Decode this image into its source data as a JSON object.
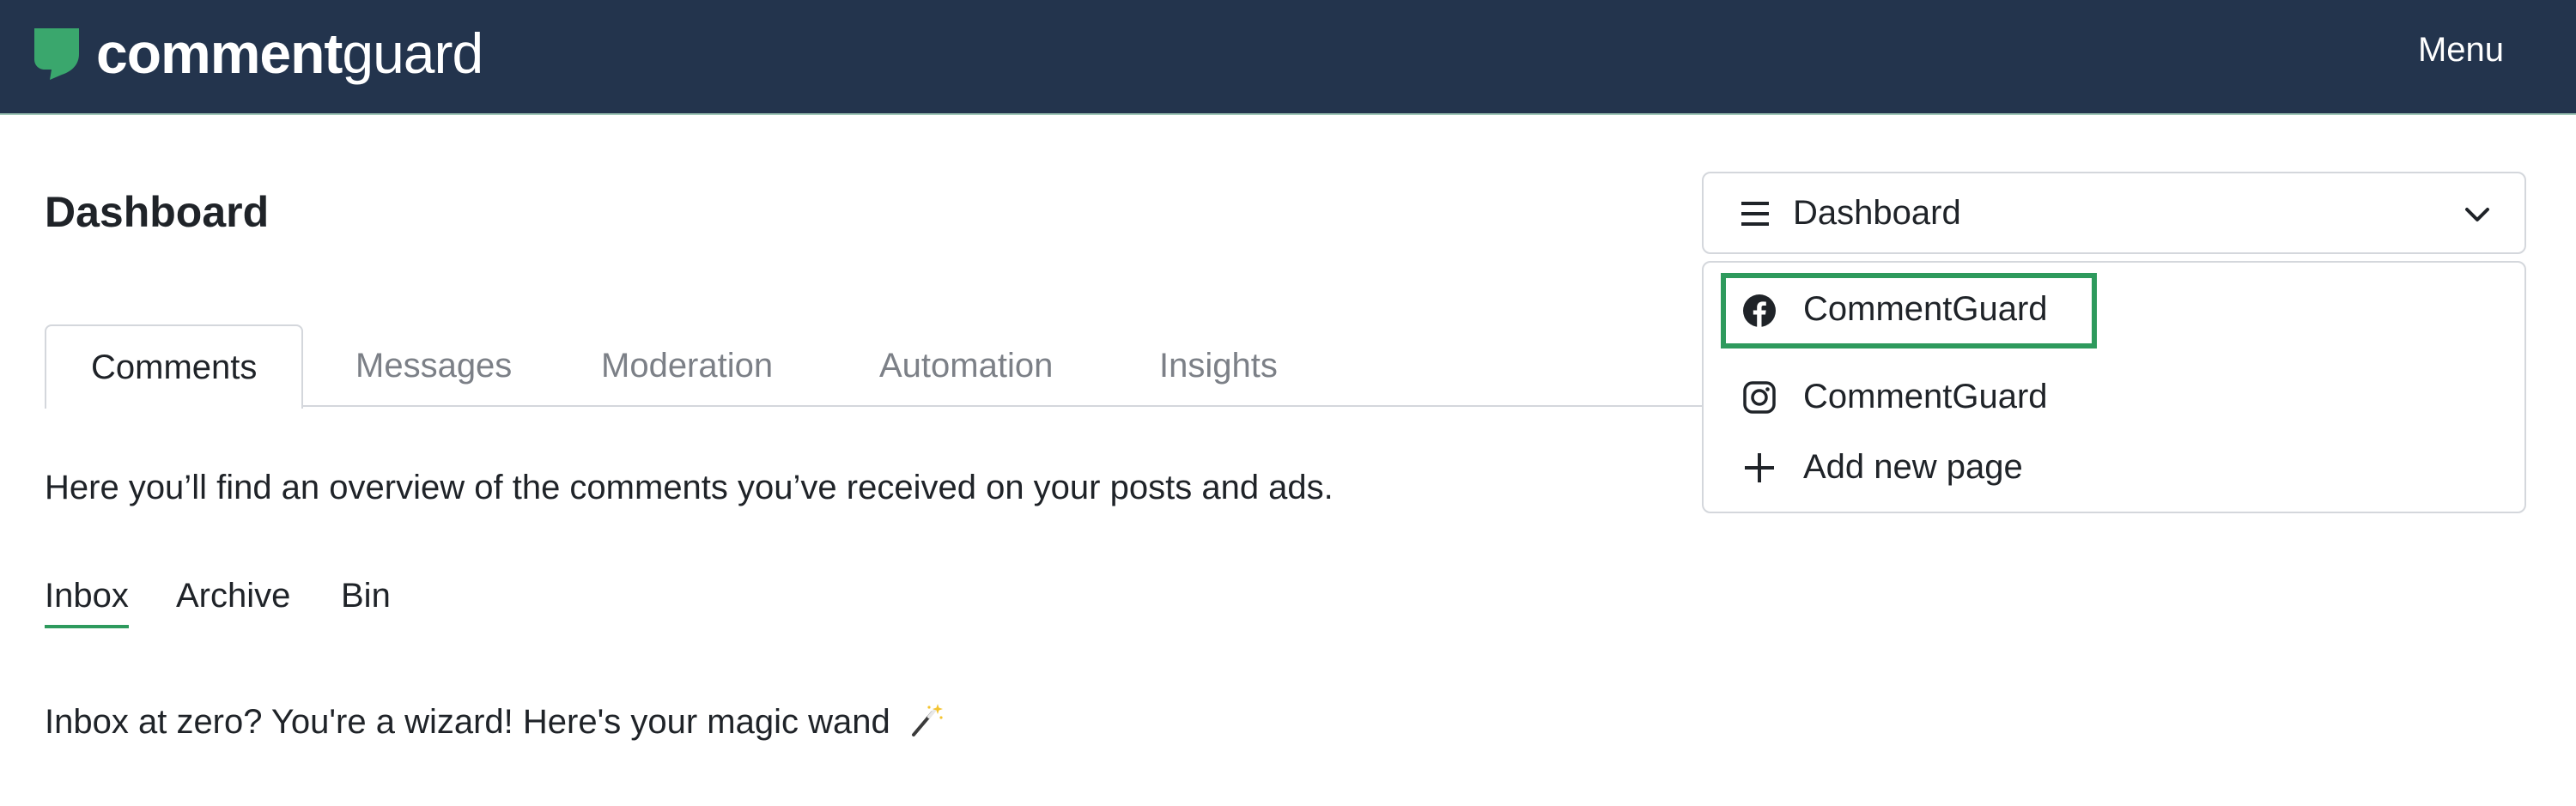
{
  "header": {
    "brand_bold": "comment",
    "brand_light": "guard",
    "menu_label": "Menu"
  },
  "page": {
    "title": "Dashboard",
    "description": "Here you’ll find an overview of the comments you’ve received on your posts and ads."
  },
  "page_select": {
    "selected": "Dashboard",
    "options": [
      {
        "label": "CommentGuard",
        "icon": "facebook-icon"
      },
      {
        "label": "CommentGuard",
        "icon": "instagram-icon"
      },
      {
        "label": "Add new page",
        "icon": "plus-icon"
      }
    ]
  },
  "tabs": [
    {
      "label": "Comments",
      "active": true
    },
    {
      "label": "Messages"
    },
    {
      "label": "Moderation"
    },
    {
      "label": "Automation"
    },
    {
      "label": "Insights"
    }
  ],
  "subtabs": [
    {
      "label": "Inbox",
      "active": true
    },
    {
      "label": "Archive"
    },
    {
      "label": "Bin"
    }
  ],
  "empty_state": {
    "text": "Inbox at zero? You're a wizard! Here's your magic wand",
    "icon": "magic-wand-icon"
  },
  "colors": {
    "header_bg": "#23344d",
    "brand_green": "#3aa76d",
    "highlight": "#2e9a5d"
  }
}
